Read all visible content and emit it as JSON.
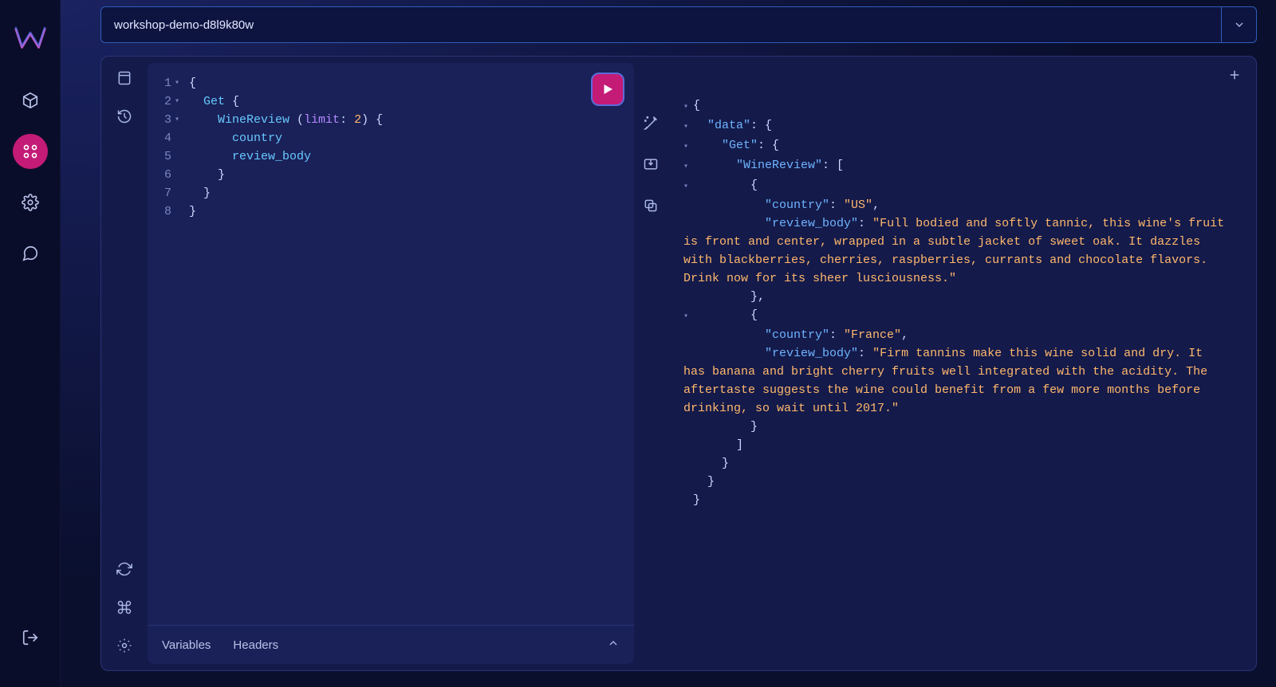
{
  "instance_selector": {
    "name": "workshop-demo-d8l9k80w"
  },
  "sidebar_icons": {
    "logo": "logo",
    "cube": "cube-icon",
    "query": "query-icon",
    "settings": "gear-icon",
    "chat": "chat-icon",
    "logout": "logout-icon"
  },
  "editor": {
    "lines": [
      {
        "n": "1",
        "fold": "▾",
        "text": "{",
        "tokens": [
          [
            "{",
            "pun"
          ]
        ]
      },
      {
        "n": "2",
        "fold": "▾",
        "text": "  Get {",
        "tokens": [
          [
            "  ",
            "pun"
          ],
          [
            "Get",
            "field"
          ],
          [
            " {",
            "pun"
          ]
        ]
      },
      {
        "n": "3",
        "fold": "▾",
        "text": "    WineReview (limit: 2) {",
        "tokens": [
          [
            "    ",
            "pun"
          ],
          [
            "WineReview",
            "field"
          ],
          [
            " (",
            "pun"
          ],
          [
            "limit",
            "arg"
          ],
          [
            ": ",
            "pun"
          ],
          [
            "2",
            "num"
          ],
          [
            ") {",
            "pun"
          ]
        ]
      },
      {
        "n": "4",
        "fold": "",
        "text": "      country",
        "tokens": [
          [
            "      ",
            "pun"
          ],
          [
            "country",
            "field"
          ]
        ]
      },
      {
        "n": "5",
        "fold": "",
        "text": "      review_body",
        "tokens": [
          [
            "      ",
            "pun"
          ],
          [
            "review_body",
            "field"
          ]
        ]
      },
      {
        "n": "6",
        "fold": "",
        "text": "    }",
        "tokens": [
          [
            "    }",
            "pun"
          ]
        ]
      },
      {
        "n": "7",
        "fold": "",
        "text": "  }",
        "tokens": [
          [
            "  }",
            "pun"
          ]
        ]
      },
      {
        "n": "8",
        "fold": "",
        "text": "}",
        "tokens": [
          [
            "}",
            "pun"
          ]
        ]
      }
    ],
    "footer_tabs": {
      "variables": "Variables",
      "headers": "Headers"
    }
  },
  "response": {
    "lines": [
      {
        "fold": "▾",
        "tokens": [
          [
            "{",
            "pun"
          ]
        ]
      },
      {
        "fold": "▾",
        "tokens": [
          [
            "  ",
            "pun"
          ],
          [
            "\"data\"",
            "key"
          ],
          [
            ": {",
            "pun"
          ]
        ]
      },
      {
        "fold": "▾",
        "tokens": [
          [
            "    ",
            "pun"
          ],
          [
            "\"Get\"",
            "key"
          ],
          [
            ": {",
            "pun"
          ]
        ]
      },
      {
        "fold": "▾",
        "tokens": [
          [
            "      ",
            "pun"
          ],
          [
            "\"WineReview\"",
            "key"
          ],
          [
            ": [",
            "pun"
          ]
        ]
      },
      {
        "fold": "▾",
        "tokens": [
          [
            "        {",
            "pun"
          ]
        ]
      },
      {
        "fold": "",
        "tokens": [
          [
            "          ",
            "pun"
          ],
          [
            "\"country\"",
            "key"
          ],
          [
            ": ",
            "pun"
          ],
          [
            "\"US\"",
            "str"
          ],
          [
            ",",
            "pun"
          ]
        ]
      },
      {
        "fold": "",
        "tokens": [
          [
            "          ",
            "pun"
          ],
          [
            "\"review_body\"",
            "key"
          ],
          [
            ": ",
            "pun"
          ],
          [
            "\"Full bodied and softly tannic, this wine's fruit is front and center, wrapped in a subtle jacket of sweet oak. It dazzles with blackberries, cherries, raspberries, currants and chocolate flavors. Drink now for its sheer lusciousness.\"",
            "str"
          ]
        ]
      },
      {
        "fold": "",
        "tokens": [
          [
            "        },",
            "pun"
          ]
        ]
      },
      {
        "fold": "▾",
        "tokens": [
          [
            "        {",
            "pun"
          ]
        ]
      },
      {
        "fold": "",
        "tokens": [
          [
            "          ",
            "pun"
          ],
          [
            "\"country\"",
            "key"
          ],
          [
            ": ",
            "pun"
          ],
          [
            "\"France\"",
            "str"
          ],
          [
            ",",
            "pun"
          ]
        ]
      },
      {
        "fold": "",
        "tokens": [
          [
            "          ",
            "pun"
          ],
          [
            "\"review_body\"",
            "key"
          ],
          [
            ": ",
            "pun"
          ],
          [
            "\"Firm tannins make this wine solid and dry. It has banana and bright cherry fruits well integrated with the acidity. The aftertaste suggests the wine could benefit from a few more months before drinking, so wait until 2017.\"",
            "str"
          ]
        ]
      },
      {
        "fold": "",
        "tokens": [
          [
            "        }",
            "pun"
          ]
        ]
      },
      {
        "fold": "",
        "tokens": [
          [
            "      ]",
            "pun"
          ]
        ]
      },
      {
        "fold": "",
        "tokens": [
          [
            "    }",
            "pun"
          ]
        ]
      },
      {
        "fold": "",
        "tokens": [
          [
            "  }",
            "pun"
          ]
        ]
      },
      {
        "fold": "",
        "tokens": [
          [
            "}",
            "pun"
          ]
        ]
      }
    ]
  }
}
